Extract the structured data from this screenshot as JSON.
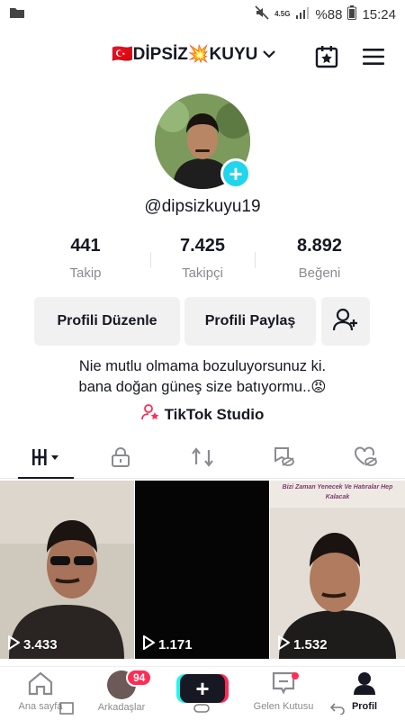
{
  "status_bar": {
    "battery": "%88",
    "time": "15:24",
    "network": "4.5G"
  },
  "header": {
    "username": "🇹🇷DİPSİZ💥KUYU",
    "dropdown_icon": "chevron-down-icon",
    "creator_icon": "calendar-star-icon",
    "menu_icon": "hamburger-menu-icon"
  },
  "profile": {
    "handle": "@dipsizkuyu19",
    "stats": [
      {
        "value": "441",
        "label": "Takip"
      },
      {
        "value": "7.425",
        "label": "Takipçi"
      },
      {
        "value": "8.892",
        "label": "Beğeni"
      }
    ],
    "edit_label": "Profili Düzenle",
    "share_label": "Profili Paylaş",
    "bio_line1": "Nie mutlu olmama bozuluyorsunuz ki.",
    "bio_line2": "bana doğan güneş size batıyormu..😡",
    "studio_label": "TikTok Studio"
  },
  "videos": [
    {
      "views": "3.433"
    },
    {
      "views": "1.171"
    },
    {
      "views": "1.532",
      "caption": "Bizi Zaman Yenecek Ve Hatıralar Hep Kalacak"
    }
  ],
  "nav": {
    "home": "Ana sayfa",
    "friends": "Arkadaşlar",
    "friends_badge": "94",
    "create": "+",
    "inbox": "Gelen Kutusu",
    "profile": "Profil"
  },
  "colors": {
    "accent": "#fe2c55",
    "cyan": "#20d5ec"
  }
}
